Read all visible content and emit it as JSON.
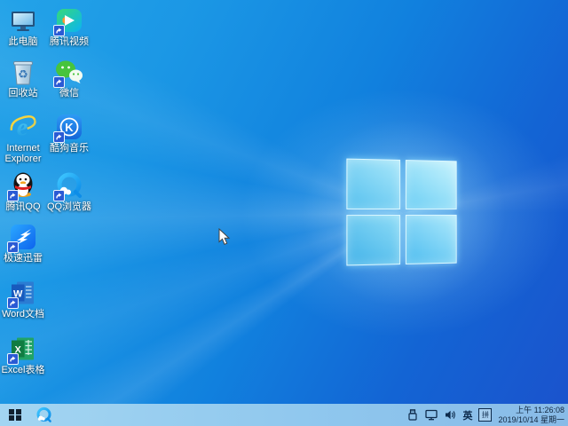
{
  "desktop": {
    "icons": [
      {
        "label": "此电脑"
      },
      {
        "label": "腾讯视频"
      },
      {
        "label": "回收站"
      },
      {
        "label": "微信"
      },
      {
        "label": "Internet Explorer"
      },
      {
        "label": "酷狗音乐"
      },
      {
        "label": "腾讯QQ"
      },
      {
        "label": "QQ浏览器"
      },
      {
        "label": "极速迅雷"
      },
      {
        "label": "Word文档"
      },
      {
        "label": "Excel表格"
      }
    ]
  },
  "taskbar": {
    "tray": {
      "language": "英",
      "ime": "拼",
      "time": "上午 11:26:08",
      "date": "2019/10/14 星期一"
    }
  },
  "colors": {
    "wallpaper_top_left": "#1b9be8",
    "wallpaper_bottom_right": "#1a50c8",
    "logo_pane": "#5fc9f3",
    "taskbar_tint": "#97cfee",
    "tray_text": "#0d2b4c"
  }
}
